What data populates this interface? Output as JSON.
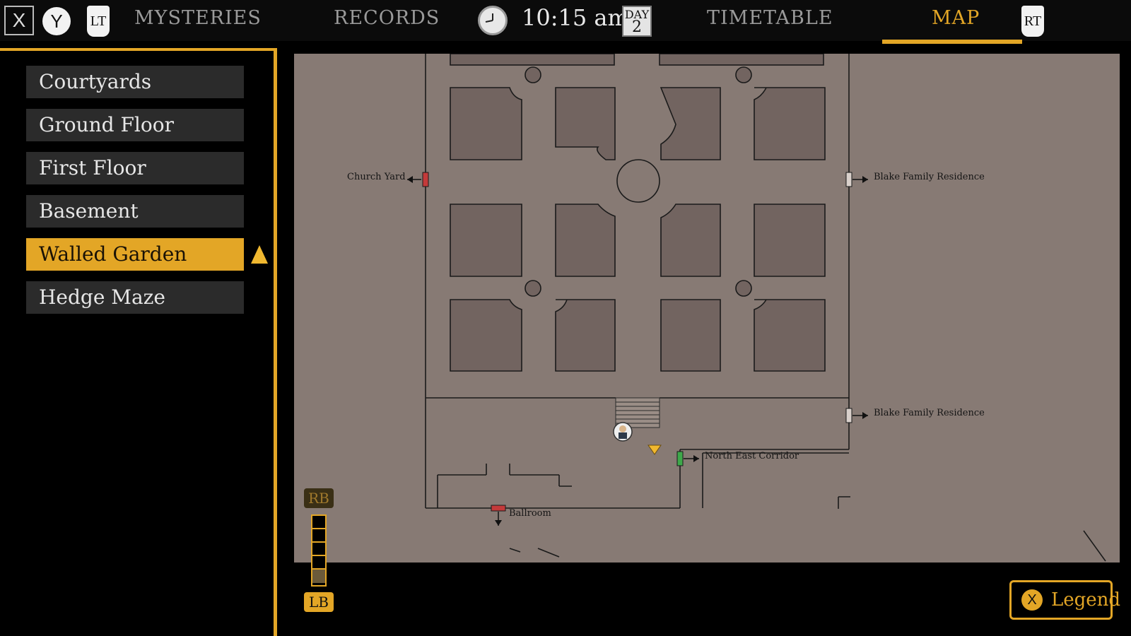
{
  "topbar": {
    "btn_x": "X",
    "btn_y": "Y",
    "btn_lt": "LT",
    "btn_rt": "RT",
    "tabs": [
      "MYSTERIES",
      "RECORDS",
      "TIMETABLE",
      "MAP"
    ],
    "active_tab": "MAP",
    "time": "10:15 am",
    "day_label": "DAY",
    "day_number": "2"
  },
  "sidebar": {
    "items": [
      {
        "label": "Courtyards"
      },
      {
        "label": "Ground Floor"
      },
      {
        "label": "First Floor"
      },
      {
        "label": "Basement"
      },
      {
        "label": "Walled Garden",
        "selected": true
      },
      {
        "label": "Hedge Maze"
      }
    ]
  },
  "map": {
    "labels": {
      "church_yard": "Church Yard",
      "blake_top": "Blake Family Residence",
      "blake_bottom": "Blake Family Residence",
      "north_east": "North East Corridor",
      "ballroom": "Ballroom"
    }
  },
  "floor_selector": {
    "up": "RB",
    "down": "LB"
  },
  "legend": {
    "button": "X",
    "label": "Legend"
  },
  "colors": {
    "accent": "#e3a626",
    "map_bg": "#877a74",
    "bed_fill": "#726460"
  }
}
